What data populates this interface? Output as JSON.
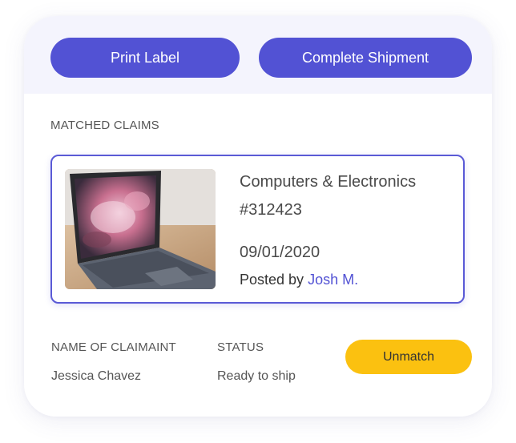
{
  "actions": {
    "print_label": "Print Label",
    "complete_shipment": "Complete Shipment"
  },
  "matched_claims": {
    "section_label": "MATCHED CLAIMS",
    "claim": {
      "image_icon": "laptop-photo",
      "category": "Computers & Electronics",
      "id": "#312423",
      "date": "09/01/2020",
      "posted_by_prefix": "Posted by ",
      "posted_by_name": "Josh M."
    }
  },
  "claimant": {
    "name_label": "NAME OF CLAIMAINT",
    "name_value": "Jessica Chavez",
    "status_label": "STATUS",
    "status_value": "Ready to ship",
    "unmatch_label": "Unmatch"
  },
  "colors": {
    "primary": "#5252d4",
    "accent": "#fbc110",
    "header_bg": "#f4f4fd"
  }
}
